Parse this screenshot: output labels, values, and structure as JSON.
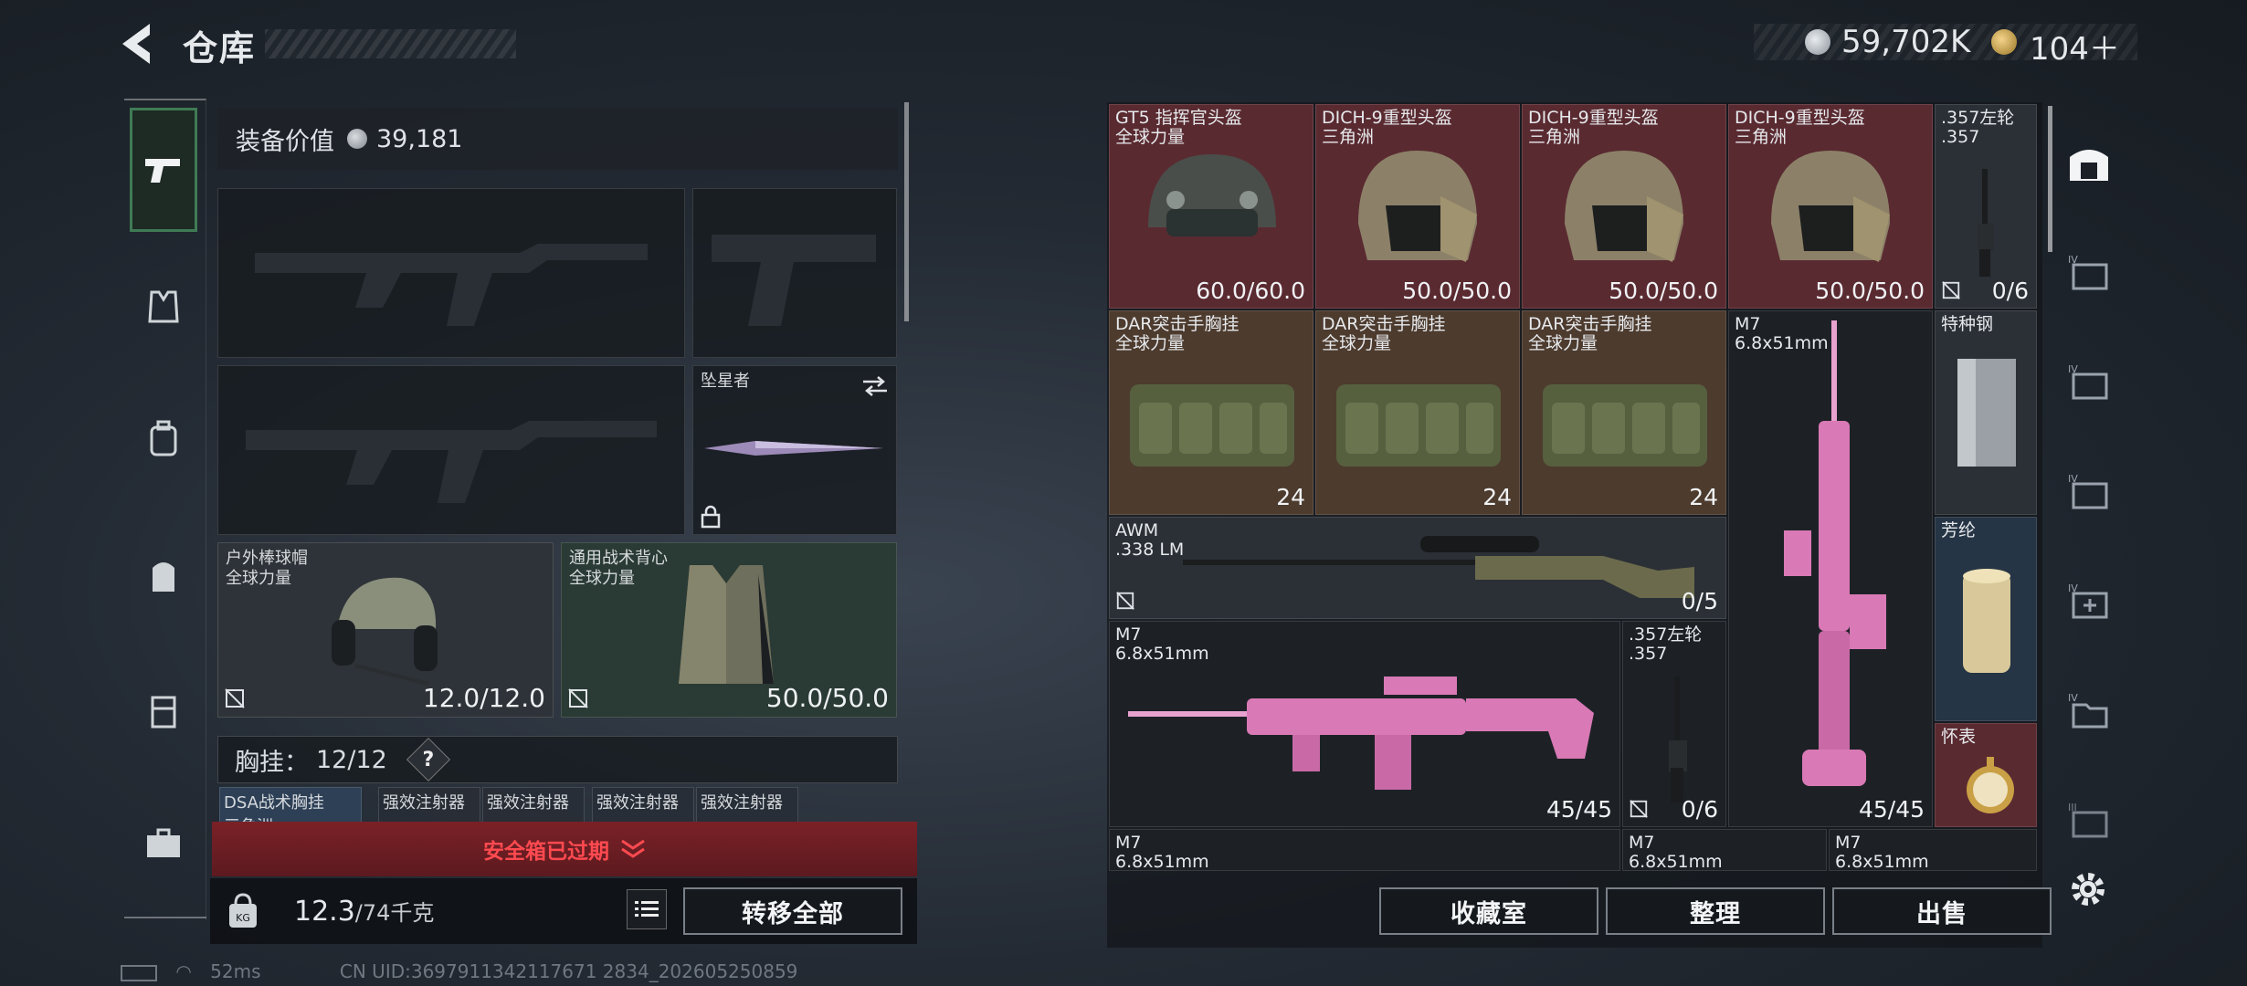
{
  "header": {
    "title": "仓库",
    "money": "59,702K",
    "tickets": "104＋"
  },
  "left": {
    "equip_label": "装备价值",
    "equip_value": "39,181",
    "melee_name": "坠星者",
    "helmet": {
      "name": "户外棒球帽",
      "region": "全球力量",
      "durability": "12.0/12.0"
    },
    "armor": {
      "name": "通用战术背心",
      "region": "全球力量",
      "durability": "50.0/50.0"
    },
    "vest_label": "胸挂：",
    "vest_capacity": "12/12",
    "help": "?",
    "small_items": [
      "DSA战术胸挂",
      "强效注射器",
      "强效注射器",
      "强效注射器",
      "强效注射器"
    ],
    "small_item_sub": "三角洲",
    "alert": "安全箱已过期",
    "weight": "12.3",
    "weight_max": "/74千克",
    "transfer_all": "转移全部"
  },
  "grid": {
    "items": [
      {
        "name": "GT5 指挥官头盔",
        "sub": "全球力量",
        "value": "60.0/60.0"
      },
      {
        "name": "DICH-9重型头盔",
        "sub": "三角洲",
        "value": "50.0/50.0"
      },
      {
        "name": "DICH-9重型头盔",
        "sub": "三角洲",
        "value": "50.0/50.0"
      },
      {
        "name": "DICH-9重型头盔",
        "sub": "三角洲",
        "value": "50.0/50.0"
      },
      {
        "name": ".357左轮",
        "sub": ".357",
        "value": "0/6"
      },
      {
        "name": "DAR突击手胸挂",
        "sub": "全球力量",
        "value": "24"
      },
      {
        "name": "DAR突击手胸挂",
        "sub": "全球力量",
        "value": "24"
      },
      {
        "name": "DAR突击手胸挂",
        "sub": "全球力量",
        "value": "24"
      },
      {
        "name": "M7",
        "sub": "6.8x51mm",
        "value": "45/45"
      },
      {
        "name": "特种钢",
        "sub": "",
        "value": ""
      },
      {
        "name": "AWM",
        "sub": ".338 LM",
        "value": "0/5"
      },
      {
        "name": "芳纶",
        "sub": "",
        "value": ""
      },
      {
        "name": "M7",
        "sub": "6.8x51mm",
        "value": "45/45"
      },
      {
        "name": ".357左轮",
        "sub": ".357",
        "value": "0/6"
      },
      {
        "name": "怀表",
        "sub": "",
        "value": ""
      },
      {
        "name": "M7",
        "sub": "6.8x51mm",
        "value": ""
      },
      {
        "name": "M7",
        "sub": "6.8x51mm",
        "value": ""
      },
      {
        "name": "M7",
        "sub": "6.8x51mm",
        "value": ""
      }
    ],
    "buttons": {
      "collection": "收藏室",
      "sort": "整理",
      "sell": "出售"
    }
  },
  "status": {
    "ping": "52ms",
    "uid": "CN UID:3697911342117671 2834_202605250859"
  }
}
